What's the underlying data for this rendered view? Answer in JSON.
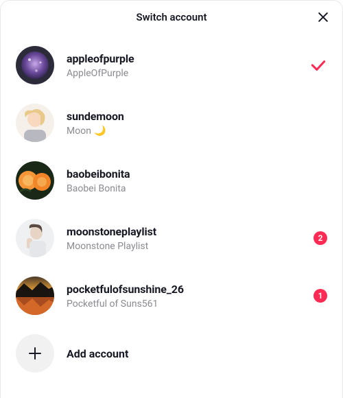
{
  "header": {
    "title": "Switch account"
  },
  "accounts": [
    {
      "username": "appleofpurple",
      "displayname": "AppleOfPurple",
      "selected": true,
      "badge": null,
      "moon": false
    },
    {
      "username": "sundemoon",
      "displayname": "Moon",
      "selected": false,
      "badge": null,
      "moon": true
    },
    {
      "username": "baobeibonita",
      "displayname": "Baobei Bonita",
      "selected": false,
      "badge": null,
      "moon": false
    },
    {
      "username": "moonstoneplaylist",
      "displayname": "Moonstone Playlist",
      "selected": false,
      "badge": "2",
      "moon": false
    },
    {
      "username": "pocketfulofsunshine_26",
      "displayname": "Pocketful of Suns561",
      "selected": false,
      "badge": "1",
      "moon": false
    }
  ],
  "add_account": {
    "label": "Add account"
  },
  "icons": {
    "close": "close-icon",
    "check": "check-icon",
    "plus": "plus-icon",
    "moon": "🌙"
  },
  "colors": {
    "accent": "#fe2c55",
    "text": "#161823",
    "muted": "#8a8b91"
  }
}
